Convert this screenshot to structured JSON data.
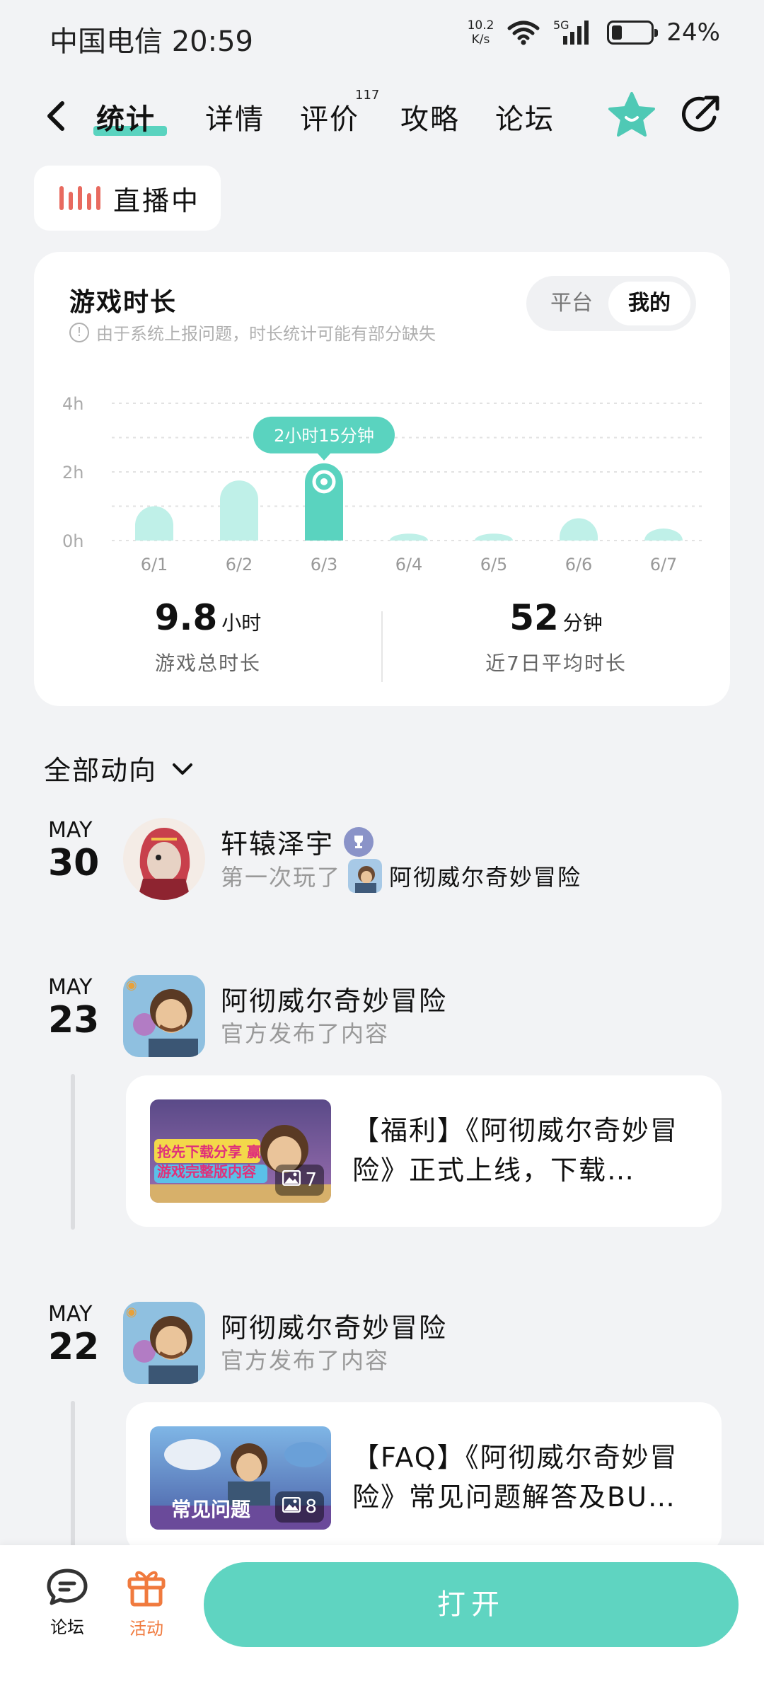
{
  "status_bar": {
    "carrier": "中国电信",
    "time": "20:59",
    "net_speed_value": "10.2",
    "net_speed_unit": "K/s",
    "signal": "5G",
    "battery": "24%"
  },
  "nav": {
    "tabs": [
      {
        "label": "统计"
      },
      {
        "label": "详情"
      },
      {
        "label": "评价",
        "badge": "117"
      },
      {
        "label": "攻略"
      },
      {
        "label": "论坛"
      }
    ],
    "active_tab": "统计",
    "accent_color": "#5ad3bf"
  },
  "live": {
    "label": "直播中",
    "color": "#e86a5f"
  },
  "stats": {
    "title": "游戏时长",
    "note": "由于系统上报问题，时长统计可能有部分缺失",
    "toggle": {
      "platform": "平台",
      "mine": "我的",
      "selected": "我的"
    },
    "total_value": "9.8",
    "total_unit": "小时",
    "total_label": "游戏总时长",
    "avg_value": "52",
    "avg_unit": "分钟",
    "avg_label": "近7日平均时长"
  },
  "chart_data": {
    "type": "bar",
    "categories": [
      "6/1",
      "6/2",
      "6/3",
      "6/4",
      "6/5",
      "6/6",
      "6/7"
    ],
    "values": [
      1.0,
      1.75,
      2.25,
      0.2,
      0.2,
      0.65,
      0.35
    ],
    "y_unit": "h",
    "yticks": [
      "0h",
      "2h",
      "4h"
    ],
    "ylim": [
      0,
      4
    ],
    "highlight_index": 2,
    "tooltip": "2小时15分钟",
    "grid": true,
    "colors": {
      "bar": "#bff0e8",
      "highlight": "#5ad3bf"
    }
  },
  "feed": {
    "filter_label": "全部动向",
    "entries": [
      {
        "month": "MAY",
        "day": "30",
        "title": "轩辕泽宇",
        "subtitle": "第一次玩了",
        "game": "阿彻威尔奇妙冒险"
      },
      {
        "month": "MAY",
        "day": "23",
        "title": "阿彻威尔奇妙冒险",
        "subtitle": "官方发布了内容",
        "post": {
          "title": "【福利】《阿彻威尔奇妙冒险》正式上线，下载…",
          "image_count": "7",
          "thumb_text": "抢先下载分享 赢游戏完整版内容"
        }
      },
      {
        "month": "MAY",
        "day": "22",
        "title": "阿彻威尔奇妙冒险",
        "subtitle": "官方发布了内容",
        "post": {
          "title": "【FAQ】《阿彻威尔奇妙冒险》常见问题解答及BU…",
          "image_count": "8",
          "thumb_text": "常见问题"
        }
      }
    ]
  },
  "bottom": {
    "forum_label": "论坛",
    "activity_label": "活动",
    "open_label": "打开"
  }
}
